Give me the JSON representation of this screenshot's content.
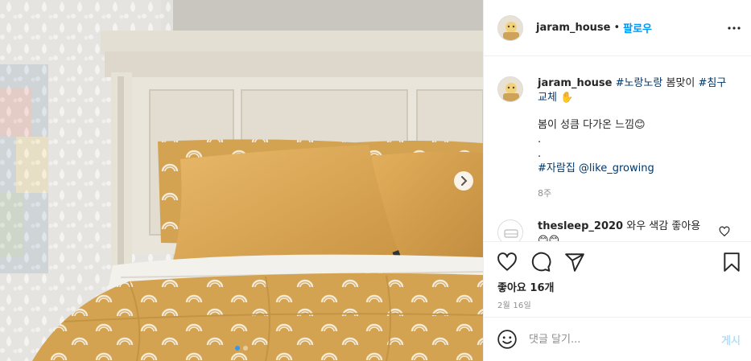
{
  "post": {
    "username": "jaram_house",
    "separator": "•",
    "follow_label": "팔로우"
  },
  "caption": {
    "username": "jaram_house",
    "tag_1": "#노랑노랑",
    "word_1": "봄맞이",
    "tag_2": "#침구교체",
    "emoji_1": "✋",
    "body": "봄이 성큼 다가온 느낌😊",
    "dot_1": ".",
    "dot_2": ".",
    "tag_3": "#자람집",
    "mention": "@like_growing",
    "time_ago": "8주"
  },
  "reply": {
    "username": "thesleep_2020",
    "text": "와우 색감 좋아용",
    "emojis": "😊😊"
  },
  "actions": {
    "likes_label": "좋아요 16개",
    "date_label": "2월 16일"
  },
  "comment_box": {
    "placeholder": "댓글 달기...",
    "post_label": "게시"
  },
  "carousel": {
    "total_slides": 2,
    "active_index": 0
  },
  "colors": {
    "link_blue": "#0095f6",
    "hashtag": "#00376b",
    "muted": "#8e8e8e",
    "mustard": "#d9ac5f"
  },
  "icons": [
    "more-icon",
    "heart-icon",
    "comment-icon",
    "share-icon",
    "bookmark-icon",
    "emoji-icon",
    "chevron-right-icon"
  ]
}
